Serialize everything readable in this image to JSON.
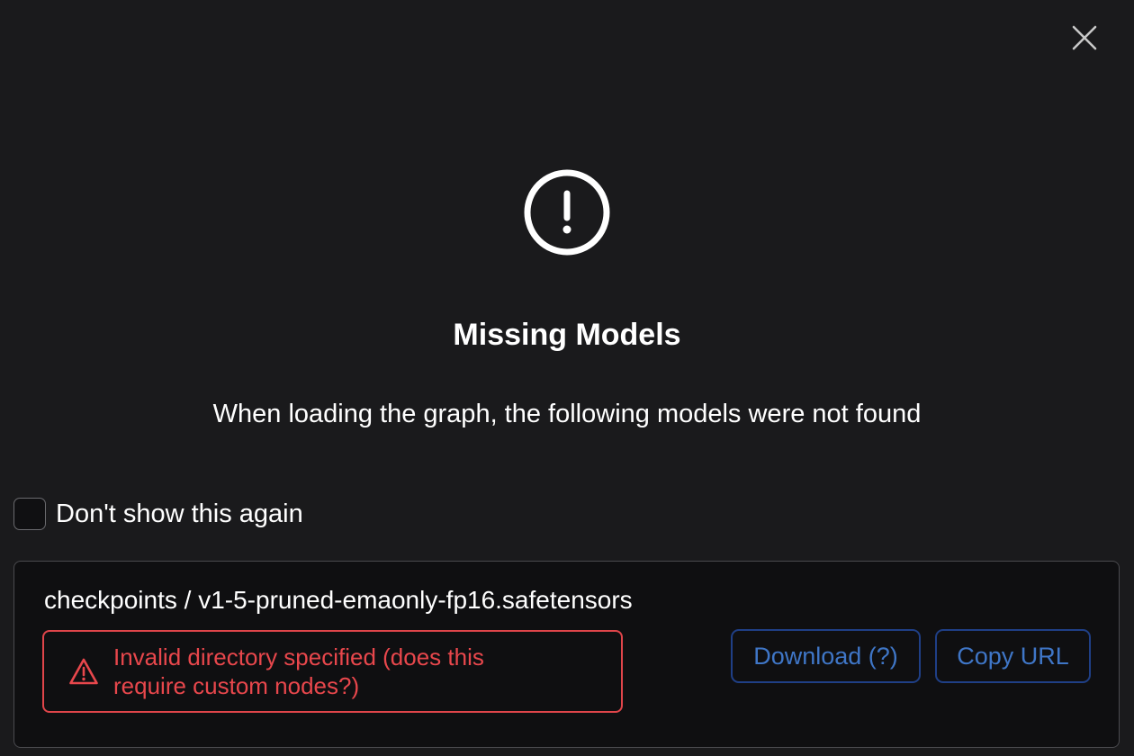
{
  "dialog": {
    "title": "Missing Models",
    "message": "When loading the graph, the following models were not found",
    "dont_show_again_label": "Don't show this again",
    "dont_show_again_checked": false
  },
  "models": [
    {
      "name": "checkpoints / v1-5-pruned-emaonly-fp16.safetensors",
      "error": "Invalid directory specified (does this require custom nodes?)",
      "download_label": "Download (?)",
      "copy_url_label": "Copy URL"
    }
  ],
  "icons": {
    "close": "close-icon",
    "warning_circle": "exclamation-circle-icon",
    "error_triangle": "warning-triangle-icon"
  },
  "colors": {
    "background": "#1a1a1c",
    "card_background": "#0f0f11",
    "error": "#e8474c",
    "button_text": "#3f76c7",
    "button_border": "#1f3f86"
  }
}
